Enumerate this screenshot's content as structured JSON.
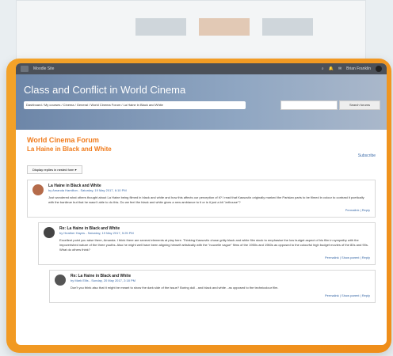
{
  "topbar": {
    "site": "Moodle Site",
    "user": "Brian Franklin"
  },
  "header": {
    "course_title": "Class and Conflict in World Cinema",
    "breadcrumb": "Dashboard / My courses / Cinema / General / World Cinema Forum / La Haine in Black and White",
    "search_button": "Search forums"
  },
  "main": {
    "forum_title": "World Cinema Forum",
    "discussion_title": "La Haine in Black and White",
    "subscribe": "Subscribe",
    "display_mode": "Display replies in nested form"
  },
  "posts": [
    {
      "title": "La Haine in Black and White",
      "byline": "by Amanda Hamilton - Saturday, 19 May 2017, 6:10 PM",
      "body": "Just wondered what others thought about La Haine being filmed in black and white and how this affects our perception of it? I read that Kassovitz originally marked the Parisian parts to be filmed in colour to contrast it poetically with the banlieue but that he wasn't able to do this. Do we feel the black and white gives a new ambiance to it or is it just a bit \"arthouse\"?",
      "links": "Permalink | Reply"
    },
    {
      "title": "Re: La Haine in Black and White",
      "byline": "by Heather Hayes - Saturday, 19 May 2017, 5:25 PM",
      "body": "Excellent point you raise there, Amanda. I think there are several elements at play here. Thinking Kassovitz chose gritty black and white film stock to emphasise the low budget aspect of his film in sympathy with the impoverished nature of the three youths. Also he might well have been aligning himself artistically with the \"nouvelle vague\" films of the 1950s and 1960s as opposed to the colourful high budget movies of the 80s and 90s. What do others think?",
      "links": "Permalink | Show parent | Reply"
    },
    {
      "title": "Re: La Haine in Black and White",
      "byline": "by Mark Ellis - Sunday, 20 May 2017, 2:18 PM",
      "body": "Don't you think also that it might be meant to show the dark side of the issue? Boring dull - and black and white - as opposed to the technicolour film.",
      "links": "Permalink | Show parent | Reply"
    }
  ]
}
